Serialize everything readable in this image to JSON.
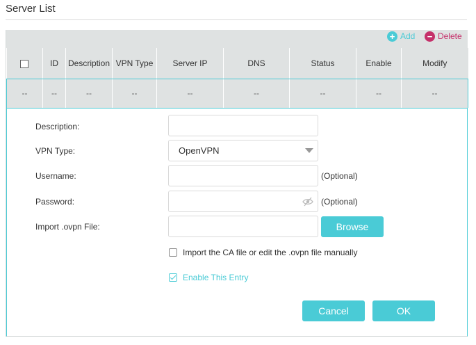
{
  "section": {
    "title": "Server List"
  },
  "toolbar": {
    "add_label": "Add",
    "add_icon": "plus-circle-icon",
    "delete_label": "Delete",
    "delete_icon": "minus-circle-icon"
  },
  "table": {
    "columns": [
      "ID",
      "Description",
      "VPN Type",
      "Server IP",
      "DNS",
      "Status",
      "Enable",
      "Modify"
    ],
    "row": [
      "--",
      "--",
      "--",
      "--",
      "--",
      "--",
      "--",
      "--",
      "--"
    ]
  },
  "form": {
    "description_label": "Description:",
    "description_value": "",
    "vpn_type_label": "VPN Type:",
    "vpn_type_value": "OpenVPN",
    "username_label": "Username:",
    "username_value": "",
    "optional_text": "(Optional)",
    "password_label": "Password:",
    "password_value": "",
    "import_label": "Import .ovpn File:",
    "import_value": "",
    "browse_label": "Browse",
    "import_ca_label": "Import the CA file or edit the .ovpn file manually",
    "import_ca_checked": false,
    "enable_label": "Enable This Entry",
    "enable_checked": true,
    "cancel_label": "Cancel",
    "ok_label": "OK"
  },
  "colors": {
    "accent": "#4acbd6",
    "delete": "#c5306a",
    "header_bg": "#dfe2e2"
  }
}
